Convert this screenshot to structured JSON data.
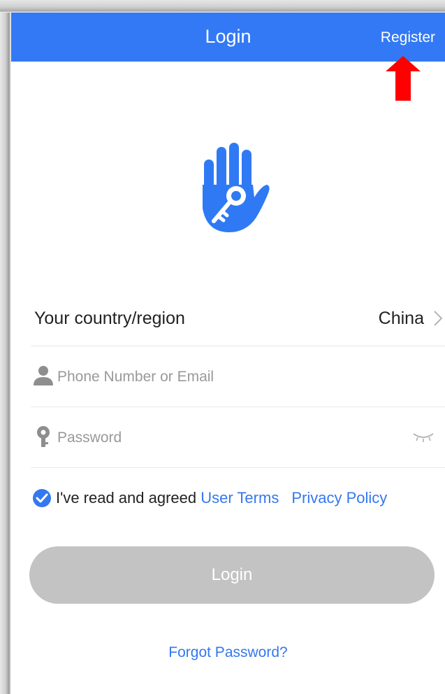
{
  "header": {
    "title": "Login",
    "register_label": "Register"
  },
  "country": {
    "label": "Your country/region",
    "value": "China"
  },
  "phone_field": {
    "placeholder": "Phone Number or Email",
    "value": ""
  },
  "password_field": {
    "placeholder": "Password",
    "value": ""
  },
  "agreement": {
    "checked": true,
    "text": "I've read and agreed",
    "user_terms": "User Terms",
    "privacy_policy": "Privacy Policy"
  },
  "login_button": {
    "label": "Login"
  },
  "forgot_password": {
    "label": "Forgot Password?"
  },
  "icons": {
    "logo": "hand-key-logo",
    "user": "person-icon",
    "password": "key-icon",
    "visibility": "eye-closed-icon",
    "checkbox": "check-circle-icon",
    "chevron": "chevron-right-icon",
    "annotation": "red-up-arrow"
  },
  "colors": {
    "primary": "#3379f5",
    "link": "#3478f0",
    "button_disabled": "#c3c3c3",
    "annotation": "#ff0000"
  }
}
